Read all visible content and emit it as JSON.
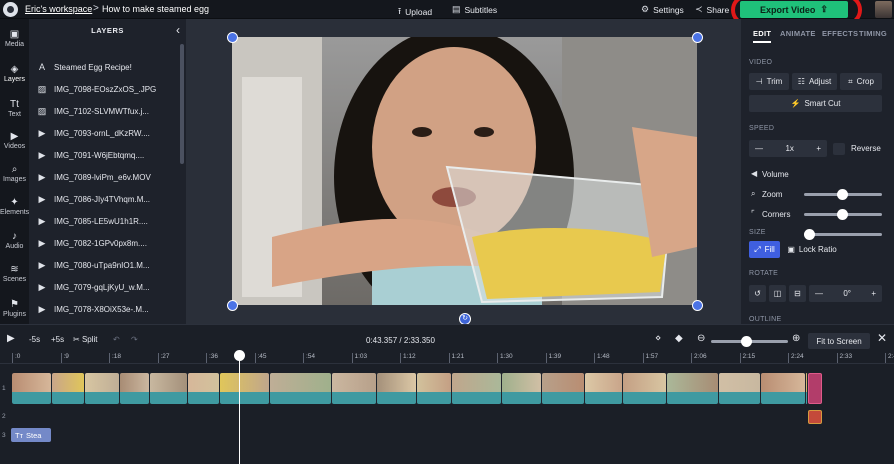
{
  "topbar": {
    "workspace": "Eric's workspace",
    "separator": ">",
    "project_title": "How to make steamed egg",
    "upload_label": "Upload",
    "subtitles_label": "Subtitles",
    "settings_label": "Settings",
    "share_label": "Share",
    "export_label": "Export Video",
    "export_color": "#1fc17a",
    "highlight_color": "#e01818"
  },
  "rail": {
    "items": [
      {
        "label": "Media",
        "icon": "media-icon"
      },
      {
        "label": "Layers",
        "icon": "layers-icon"
      },
      {
        "label": "Text",
        "icon": "text-icon"
      },
      {
        "label": "Videos",
        "icon": "videos-icon"
      },
      {
        "label": "Images",
        "icon": "images-icon"
      },
      {
        "label": "Elements",
        "icon": "elements-icon"
      },
      {
        "label": "Audio",
        "icon": "audio-icon"
      },
      {
        "label": "Scenes",
        "icon": "scenes-icon"
      },
      {
        "label": "Plugins",
        "icon": "plugins-icon"
      }
    ]
  },
  "layers": {
    "title": "LAYERS",
    "items": [
      {
        "name": "Steamed Egg Recipe!",
        "icon": "text-icon"
      },
      {
        "name": "IMG_7098-EOszZxOS_.JPG",
        "icon": "image-icon"
      },
      {
        "name": "IMG_7102-SLVMWTfux.j...",
        "icon": "image-icon"
      },
      {
        "name": "IMG_7093-ornL_dKzRW....",
        "icon": "play-icon"
      },
      {
        "name": "IMG_7091-W6jEbtqmq....",
        "icon": "play-icon"
      },
      {
        "name": "IMG_7089-lviPm_e6v.MOV",
        "icon": "play-icon"
      },
      {
        "name": "IMG_7086-JIy4TVhqm.M...",
        "icon": "play-icon"
      },
      {
        "name": "IMG_7085-LE5wU1h1R....",
        "icon": "play-icon"
      },
      {
        "name": "IMG_7082-1GPv0px8m....",
        "icon": "play-icon"
      },
      {
        "name": "IMG_7080-uTpa9nIO1.M...",
        "icon": "play-icon"
      },
      {
        "name": "IMG_7079-gqLjKyU_w.M...",
        "icon": "play-icon"
      },
      {
        "name": "IMG_7078-X8OiX53e-.M...",
        "icon": "play-icon"
      }
    ]
  },
  "props": {
    "tabs": [
      "EDIT",
      "ANIMATE",
      "EFFECTS",
      "TIMING"
    ],
    "video_section": "VIDEO",
    "trim_label": "Trim",
    "adjust_label": "Adjust",
    "crop_label": "Crop",
    "smart_cut_label": "Smart Cut",
    "speed_section": "SPEED",
    "speed_value": "1x",
    "reverse_label": "Reverse",
    "volume_label": "Volume",
    "volume_level": 0.49,
    "zoom_label": "Zoom",
    "zoom_level": 0.49,
    "corners_label": "Corners",
    "corners_level": 0.0,
    "size_section": "SIZE",
    "fill_label": "Fill",
    "lock_ratio_label": "Lock Ratio",
    "rotate_section": "ROTATE",
    "rotate_value": "0°",
    "outline_section": "OUTLINE"
  },
  "timeline": {
    "back_label": "-5s",
    "forward_label": "+5s",
    "split_label": "Split",
    "current_time": "0:43.357",
    "total_time": "2:33.350",
    "fit_label": "Fit to Screen",
    "zoom_level": 0.45,
    "ticks": [
      ":0",
      ":9",
      ":18",
      ":27",
      ":36",
      ":45",
      ":54",
      "1:03",
      "1:12",
      "1:21",
      "1:30",
      "1:39",
      "1:48",
      "1:57",
      "2:06",
      "2:15",
      "2:24",
      "2:33",
      "2:42"
    ],
    "track_numbers": [
      "1",
      "2",
      "3"
    ],
    "text_clip_label": "Stea"
  }
}
